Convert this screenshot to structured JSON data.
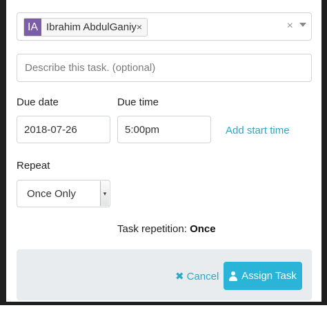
{
  "assignee": {
    "avatar_initials": "IA",
    "avatar_color": "#7b5ea7",
    "name": "Ibrahim AbdulGaniy",
    "remove_glyph": "×",
    "clear_glyph": "×"
  },
  "description": {
    "placeholder": "Describe this task. (optional)",
    "value": ""
  },
  "due_date": {
    "label": "Due date",
    "value": "2018-07-26"
  },
  "due_time": {
    "label": "Due time",
    "value": "5:00pm"
  },
  "add_start_time": "Add start time",
  "repeat": {
    "label": "Repeat",
    "selected": "Once Only",
    "dropdown_glyph": "▾"
  },
  "repetition": {
    "label": "Task repetition:",
    "value": "Once"
  },
  "footer": {
    "cancel_icon": "✖",
    "cancel_label": "Cancel",
    "assign_label": "Assign Task"
  },
  "colors": {
    "accent": "#2aa7c9",
    "primary_button": "#29b4d8",
    "footer_bg": "#e8ecef"
  }
}
